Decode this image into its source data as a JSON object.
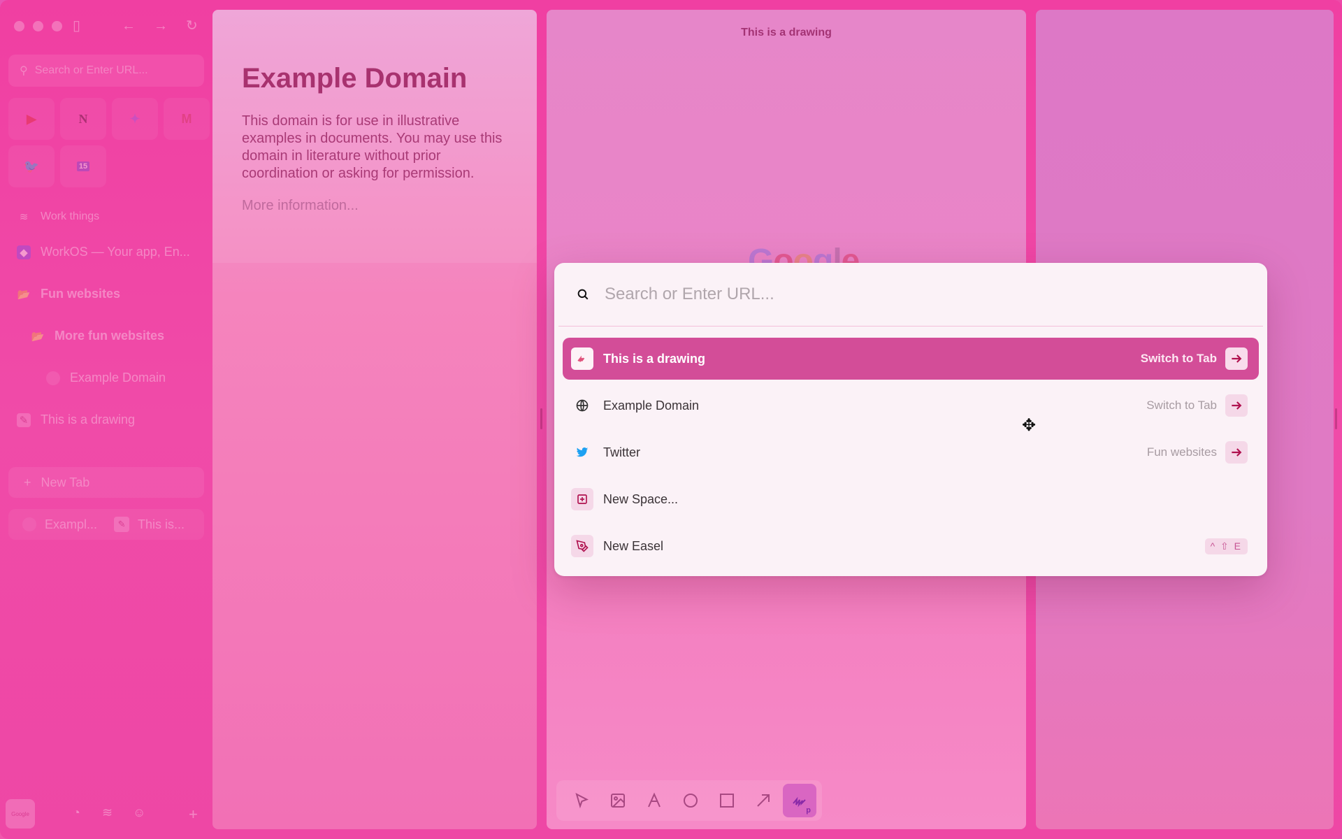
{
  "sidebar": {
    "search_placeholder": "Search or Enter URL...",
    "favorites": [
      {
        "name": "youtube",
        "glyph": "▶"
      },
      {
        "name": "notion",
        "glyph": "N"
      },
      {
        "name": "figma",
        "glyph": "✦"
      },
      {
        "name": "gmail",
        "glyph": "M"
      },
      {
        "name": "twitter",
        "glyph": "🐦"
      },
      {
        "name": "calendar",
        "glyph": "15"
      }
    ],
    "space_label": "Work things",
    "items": [
      {
        "label": "WorkOS — Your app, En..."
      },
      {
        "label": "Fun websites"
      },
      {
        "label": "More fun websites"
      },
      {
        "label": "Example Domain"
      },
      {
        "label": "This is a drawing"
      }
    ],
    "new_tab_label": "New Tab",
    "pinned": [
      {
        "label": "Exampl..."
      },
      {
        "label": "This is..."
      }
    ],
    "bottom_thumb_label": "Google"
  },
  "panes": {
    "example": {
      "title": "Example Domain",
      "body": "This domain is for use in illustrative examples in documents. You may use this domain in literature without prior coordination or asking for permission.",
      "link": "More information..."
    },
    "drawing": {
      "title": "This is a drawing",
      "logo_letters": [
        "G",
        "o",
        "o",
        "g",
        "l",
        "e"
      ],
      "tools": [
        "select",
        "image",
        "text",
        "ellipse",
        "rectangle",
        "arrow",
        "pen"
      ],
      "active_tool": "pen",
      "active_tool_shortcut": "p"
    }
  },
  "palette": {
    "search_placeholder": "Search or Enter URL...",
    "results": [
      {
        "label": "This is a drawing",
        "hint": "Switch to Tab",
        "selected": true
      },
      {
        "label": "Example Domain",
        "hint": "Switch to Tab"
      },
      {
        "label": "Twitter",
        "hint": "Fun websites"
      },
      {
        "label": "New Space..."
      },
      {
        "label": "New Easel",
        "shortcut": "^ ⇧ E"
      }
    ]
  },
  "colors": {
    "accent": "#d34d98",
    "arrow": "#b0124f",
    "background": "#f04ba8"
  }
}
